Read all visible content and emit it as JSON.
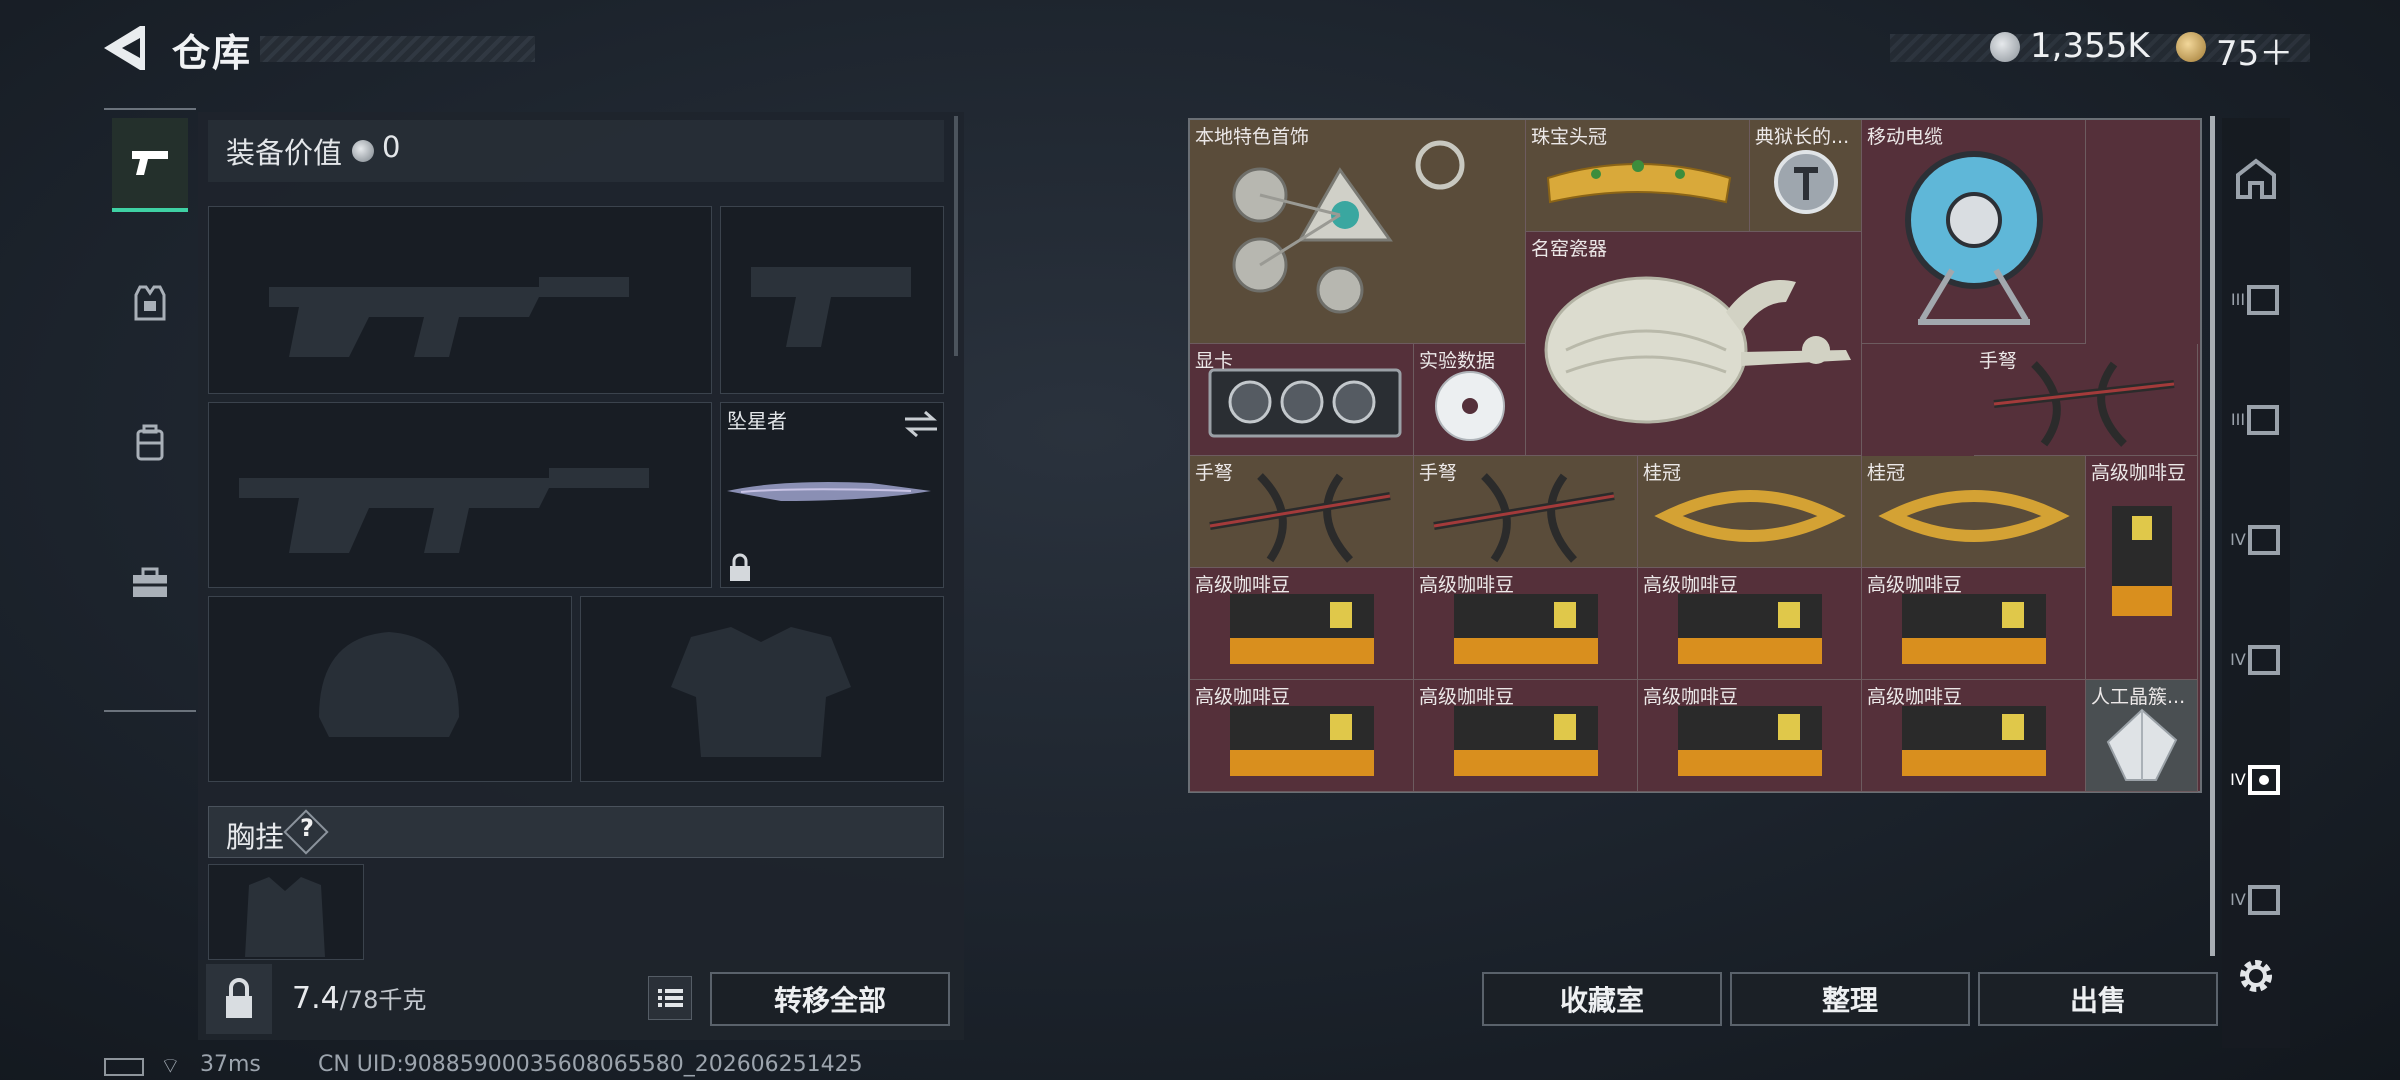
{
  "header": {
    "title": "仓库",
    "currency_1": "1,355K",
    "currency_2": "75＋"
  },
  "equipment": {
    "value_label": "装备价值",
    "value": "0",
    "knife_name": "坠星者",
    "chest_label": "胸挂",
    "help_mark": "?"
  },
  "weight": {
    "current": "7.4",
    "max": "/78千克"
  },
  "buttons": {
    "transfer_all": "转移全部",
    "collection_room": "收藏室",
    "sort": "整理",
    "sell": "出售"
  },
  "right_tabs": [
    "III",
    "III",
    "IV",
    "IV",
    "IV",
    "IV"
  ],
  "grid_items": [
    {
      "label": "本地特色首饰",
      "icon": "ornament-icon"
    },
    {
      "label": "珠宝头冠",
      "icon": "tiara-icon"
    },
    {
      "label": "典狱长的...",
      "icon": "badge-icon"
    },
    {
      "label": "移动电缆",
      "icon": "cable-reel-icon"
    },
    {
      "label": "名窑瓷器",
      "icon": "porcelain-vase-icon"
    },
    {
      "label": "显卡",
      "icon": "gpu-icon"
    },
    {
      "label": "实验数据",
      "icon": "disc-icon"
    },
    {
      "label": "手弩",
      "icon": "crossbow-icon"
    },
    {
      "label": "手弩",
      "icon": "crossbow-icon"
    },
    {
      "label": "手弩",
      "icon": "crossbow-icon"
    },
    {
      "label": "桂冠",
      "icon": "laurel-icon"
    },
    {
      "label": "桂冠",
      "icon": "laurel-icon"
    },
    {
      "label": "高级咖啡豆",
      "icon": "coffee-bag-icon"
    },
    {
      "label": "高级咖啡豆",
      "icon": "coffee-bag-icon"
    },
    {
      "label": "高级咖啡豆",
      "icon": "coffee-bag-icon"
    },
    {
      "label": "高级咖啡豆",
      "icon": "coffee-bag-icon"
    },
    {
      "label": "高级咖啡豆",
      "icon": "coffee-bag-icon"
    },
    {
      "label": "高级咖啡豆",
      "icon": "coffee-bag-icon"
    },
    {
      "label": "高级咖啡豆",
      "icon": "coffee-bag-icon"
    },
    {
      "label": "高级咖啡豆",
      "icon": "coffee-bag-icon"
    },
    {
      "label": "高级咖啡豆",
      "icon": "coffee-bag-icon"
    },
    {
      "label": "人工晶簇...",
      "icon": "crystal-icon"
    }
  ],
  "status": {
    "ping": "37ms",
    "uid": "CN UID:9088590003560806558​0_202606251425"
  },
  "colors": {
    "accent": "#3fd1a4",
    "grid_bg": "#55303a",
    "gold_cell": "#5a4c3a"
  }
}
